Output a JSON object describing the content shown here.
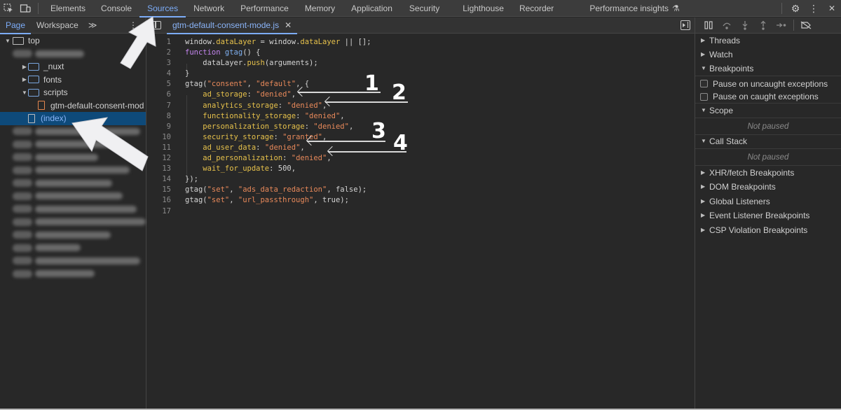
{
  "toolbar": {
    "inspect_icon": "inspect-element-icon",
    "device_icon": "device-toolbar-icon",
    "tabs": [
      {
        "label": "Elements",
        "active": false
      },
      {
        "label": "Console",
        "active": false
      },
      {
        "label": "Sources",
        "active": true
      },
      {
        "label": "Network",
        "active": false
      },
      {
        "label": "Performance",
        "active": false
      },
      {
        "label": "Memory",
        "active": false
      },
      {
        "label": "Application",
        "active": false
      },
      {
        "label": "Security",
        "active": false
      },
      {
        "label": "Lighthouse",
        "active": false
      },
      {
        "label": "Recorder",
        "active": false
      },
      {
        "label": "Performance insights",
        "active": false
      }
    ],
    "experiment_icon": "⚗",
    "settings_icon": "⚙",
    "more_icon": "⋮",
    "close_icon": "✕"
  },
  "navigator": {
    "tabs": [
      {
        "label": "Page",
        "active": true
      },
      {
        "label": "Workspace",
        "active": false
      }
    ],
    "more_tabs": "≫",
    "menu": "⋮",
    "tree": {
      "root": "top",
      "folders": [
        "_nuxt",
        "fonts",
        "scripts"
      ],
      "script_file": "gtm-default-consent-mode.js",
      "script_file_display": "gtm-default-consent-mod",
      "index_file": "(index)",
      "blurred_domains_count": 12
    }
  },
  "editor": {
    "open_file": "gtm-default-consent-mode.js",
    "close_tab": "✕",
    "lines": [
      [
        [
          "plain",
          "window."
        ],
        [
          "prop",
          "dataLayer"
        ],
        [
          "plain",
          " = window."
        ],
        [
          "prop",
          "dataLayer"
        ],
        [
          "plain",
          " || [];"
        ]
      ],
      [
        [
          "kw",
          "function"
        ],
        [
          "plain",
          " "
        ],
        [
          "fn",
          "gtag"
        ],
        [
          "plain",
          "() {"
        ]
      ],
      [
        [
          "plain",
          "    dataLayer."
        ],
        [
          "prop",
          "push"
        ],
        [
          "plain",
          "(arguments);"
        ]
      ],
      [
        [
          "plain",
          "}"
        ]
      ],
      [
        [
          "plain",
          "gtag("
        ],
        [
          "str",
          "\"consent\""
        ],
        [
          "plain",
          ", "
        ],
        [
          "str",
          "\"default\""
        ],
        [
          "plain",
          ", {"
        ]
      ],
      [
        [
          "plain",
          "    "
        ],
        [
          "prop",
          "ad_storage"
        ],
        [
          "plain",
          ": "
        ],
        [
          "str",
          "\"denied\""
        ],
        [
          "plain",
          ","
        ]
      ],
      [
        [
          "plain",
          "    "
        ],
        [
          "prop",
          "analytics_storage"
        ],
        [
          "plain",
          ": "
        ],
        [
          "str",
          "\"denied\""
        ],
        [
          "plain",
          ","
        ]
      ],
      [
        [
          "plain",
          "    "
        ],
        [
          "prop",
          "functionality_storage"
        ],
        [
          "plain",
          ": "
        ],
        [
          "str",
          "\"denied\""
        ],
        [
          "plain",
          ","
        ]
      ],
      [
        [
          "plain",
          "    "
        ],
        [
          "prop",
          "personalization_storage"
        ],
        [
          "plain",
          ": "
        ],
        [
          "str",
          "\"denied\""
        ],
        [
          "plain",
          ","
        ]
      ],
      [
        [
          "plain",
          "    "
        ],
        [
          "prop",
          "security_storage"
        ],
        [
          "plain",
          ": "
        ],
        [
          "str",
          "\"granted\""
        ],
        [
          "plain",
          ","
        ]
      ],
      [
        [
          "plain",
          "    "
        ],
        [
          "prop",
          "ad_user_data"
        ],
        [
          "plain",
          ": "
        ],
        [
          "str",
          "\"denied\""
        ],
        [
          "plain",
          ","
        ]
      ],
      [
        [
          "plain",
          "    "
        ],
        [
          "prop",
          "ad_personalization"
        ],
        [
          "plain",
          ": "
        ],
        [
          "str",
          "\"denied\""
        ],
        [
          "plain",
          ","
        ]
      ],
      [
        [
          "plain",
          "    "
        ],
        [
          "prop",
          "wait_for_update"
        ],
        [
          "plain",
          ": 500,"
        ]
      ],
      [
        [
          "plain",
          "});"
        ]
      ],
      [
        [
          "plain",
          "gtag("
        ],
        [
          "str",
          "\"set\""
        ],
        [
          "plain",
          ", "
        ],
        [
          "str",
          "\"ads_data_redaction\""
        ],
        [
          "plain",
          ", false);"
        ]
      ],
      [
        [
          "plain",
          "gtag("
        ],
        [
          "str",
          "\"set\""
        ],
        [
          "plain",
          ", "
        ],
        [
          "str",
          "\"url_passthrough\""
        ],
        [
          "plain",
          ", true);"
        ]
      ],
      []
    ],
    "annotations": [
      {
        "number": "1",
        "points_to_line": 6
      },
      {
        "number": "2",
        "points_to_line": 7
      },
      {
        "number": "3",
        "points_to_line": 11
      },
      {
        "number": "4",
        "points_to_line": 12
      }
    ]
  },
  "debugger": {
    "toolbar_icons": [
      "pause-icon",
      "step-over-icon",
      "step-into-icon",
      "step-out-icon",
      "step-icon",
      "deactivate-breakpoints-icon"
    ],
    "sections": {
      "threads": "Threads",
      "watch": "Watch",
      "breakpoints": "Breakpoints",
      "pause_uncaught": "Pause on uncaught exceptions",
      "pause_caught": "Pause on caught exceptions",
      "scope": "Scope",
      "scope_status": "Not paused",
      "call_stack": "Call Stack",
      "call_stack_status": "Not paused",
      "xhr": "XHR/fetch Breakpoints",
      "dom": "DOM Breakpoints",
      "global": "Global Listeners",
      "event": "Event Listener Breakpoints",
      "csp": "CSP Violation Breakpoints"
    }
  }
}
